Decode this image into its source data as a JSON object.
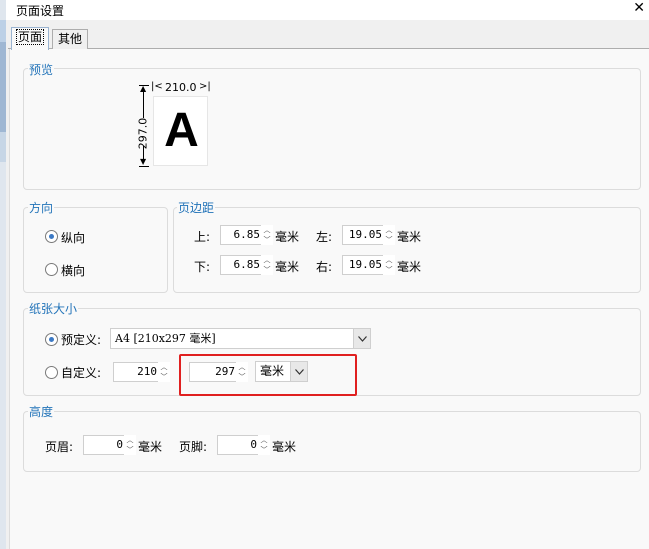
{
  "window": {
    "title": "页面设置",
    "close_glyph": "✕"
  },
  "tabs": [
    {
      "label": "页面",
      "active": true
    },
    {
      "label": "其他",
      "active": false
    }
  ],
  "preview": {
    "legend": "预览",
    "width_label": "210.0",
    "height_label": "297.0",
    "glyph": "A"
  },
  "orientation": {
    "legend": "方向",
    "portrait": "纵向",
    "landscape": "横向",
    "selected": "portrait"
  },
  "margins": {
    "legend": "页边距",
    "top_label": "上:",
    "top_value": "6.85",
    "left_label": "左:",
    "left_value": "19.05",
    "bottom_label": "下:",
    "bottom_value": "6.85",
    "right_label": "右:",
    "right_value": "19.05",
    "unit": "毫米"
  },
  "paper": {
    "legend": "纸张大小",
    "preset_label": "预定义:",
    "preset_value": "A4 [210x297 毫米]",
    "custom_label": "自定义:",
    "custom_width": "210",
    "custom_height": "297",
    "custom_unit": "毫米",
    "selected": "preset"
  },
  "height": {
    "legend": "高度",
    "header_label": "页眉:",
    "header_value": "0",
    "footer_label": "页脚:",
    "footer_value": "0",
    "unit": "毫米"
  },
  "colors": {
    "accent": "#2374b9",
    "highlight": "#e02020",
    "radio_dot": "#3c79c4"
  }
}
